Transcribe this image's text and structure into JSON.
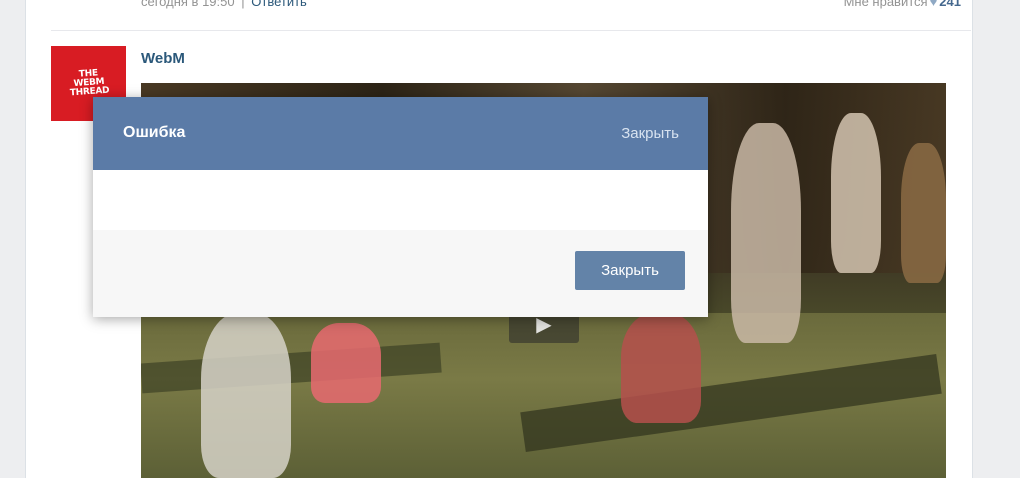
{
  "previous_post": {
    "date": "сегодня в 19:50",
    "separator": "|",
    "reply_label": "Ответить",
    "like_label": "Мне нравится",
    "like_count": "241"
  },
  "post": {
    "author": "WebM",
    "avatar_text": "THE WEBM THREAD"
  },
  "dialog": {
    "title": "Ошибка",
    "close_link": "Закрыть",
    "body_text": "",
    "close_button": "Закрыть"
  },
  "colors": {
    "header": "#5b7ba7",
    "button": "#6383a8",
    "link": "#2b587a"
  },
  "icons": {
    "like": "heart-icon",
    "video": "play-icon"
  }
}
